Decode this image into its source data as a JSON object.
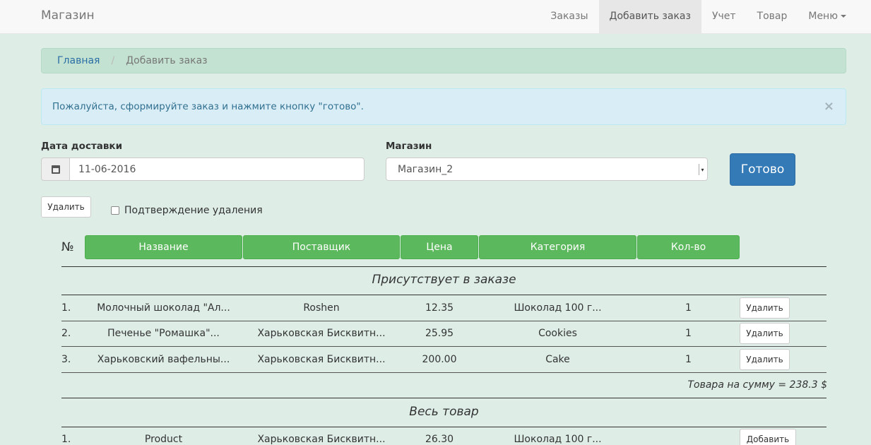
{
  "navbar": {
    "brand": "Магазин",
    "items": [
      {
        "label": "Заказы",
        "active": false
      },
      {
        "label": "Добавить заказ",
        "active": true
      },
      {
        "label": "Учет",
        "active": false
      },
      {
        "label": "Товар",
        "active": false
      },
      {
        "label": "Меню",
        "active": false
      }
    ]
  },
  "breadcrumb": {
    "home": "Главная",
    "separator": "/",
    "current": "Добавить заказ"
  },
  "alert": {
    "text": "Пожалуйста, сформируйте заказ и нажмите кнопку \"готово\".",
    "close": "×"
  },
  "form": {
    "date_label": "Дата доставки",
    "date_value": "11-06-2016",
    "store_label": "Магазин",
    "store_value": "Магазин_2",
    "submit_label": "Готово"
  },
  "controls": {
    "delete_label": "Удалить",
    "confirm_label": "Подтверждение удаления"
  },
  "table": {
    "number_sign": "№",
    "headers": [
      "Название",
      "Поставщик",
      "Цена",
      "Категория",
      "Кол-во"
    ],
    "order_section_title": "Присутствует в заказе",
    "order_rows": [
      {
        "index": "1.",
        "name": "Молочный шоколад \"Ал...",
        "supplier": "Roshen",
        "price": "12.35",
        "category": "Шоколад 100 г...",
        "qty": "1",
        "action": "Удалить"
      },
      {
        "index": "2.",
        "name": "Печенье \"Ромашка\"...",
        "supplier": "Харьковская Бисквитн...",
        "price": "25.95",
        "category": "Cookies",
        "qty": "1",
        "action": "Удалить"
      },
      {
        "index": "3.",
        "name": "Харьковский вафельны...",
        "supplier": "Харьковская Бисквитн...",
        "price": "200.00",
        "category": "Cake",
        "qty": "1",
        "action": "Удалить"
      }
    ],
    "total": "Товара на сумму = 238.3 $",
    "all_section_title": "Весь товар",
    "all_rows": [
      {
        "index": "1.",
        "name": "Product",
        "supplier": "Харьковская Бисквитн...",
        "price": "26.30",
        "category": "Шоколад 100 г...",
        "action": "Добавить"
      }
    ]
  },
  "colors": {
    "page_bg": "#deeee7",
    "primary": "#337ab7",
    "success": "#5cb85c",
    "info_bg": "#d9edf7",
    "breadcrumb_bg": "#c3e2d1"
  }
}
